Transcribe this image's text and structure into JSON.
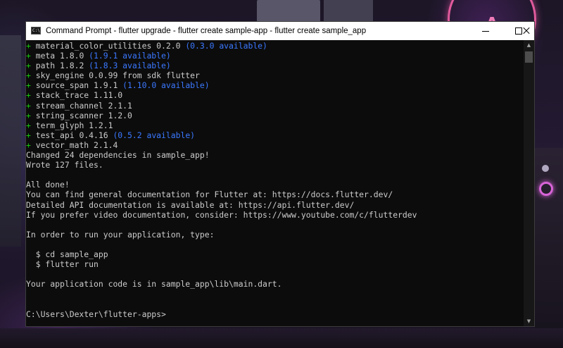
{
  "window": {
    "title": "Command Prompt - flutter  upgrade - flutter  create sample-app - flutter  create sample_app",
    "app_icon_text": "C:\\",
    "controls": {
      "minimize_icon": "minimize-icon",
      "maximize_icon": "maximize-icon",
      "close_icon": "close-icon"
    }
  },
  "colors": {
    "console_bg": "#0c0c0c",
    "console_text": "#cccccc",
    "plus_green": "#16c60c",
    "available_blue": "#3b78ff"
  },
  "console": {
    "lines": [
      {
        "prefix": "+ ",
        "text": "material_color_utilities 0.2.0 ",
        "note": "(0.3.0 available)"
      },
      {
        "prefix": "+ ",
        "text": "meta 1.8.0 ",
        "note": "(1.9.1 available)"
      },
      {
        "prefix": "+ ",
        "text": "path 1.8.2 ",
        "note": "(1.8.3 available)"
      },
      {
        "prefix": "+ ",
        "text": "sky_engine 0.0.99 from sdk flutter",
        "note": ""
      },
      {
        "prefix": "+ ",
        "text": "source_span 1.9.1 ",
        "note": "(1.10.0 available)"
      },
      {
        "prefix": "+ ",
        "text": "stack_trace 1.11.0",
        "note": ""
      },
      {
        "prefix": "+ ",
        "text": "stream_channel 2.1.1",
        "note": ""
      },
      {
        "prefix": "+ ",
        "text": "string_scanner 1.2.0",
        "note": ""
      },
      {
        "prefix": "+ ",
        "text": "term_glyph 1.2.1",
        "note": ""
      },
      {
        "prefix": "+ ",
        "text": "test_api 0.4.16 ",
        "note": "(0.5.2 available)"
      },
      {
        "prefix": "+ ",
        "text": "vector_math 2.1.4",
        "note": ""
      },
      {
        "prefix": "",
        "text": "Changed 24 dependencies in sample_app!",
        "note": ""
      },
      {
        "prefix": "",
        "text": "Wrote 127 files.",
        "note": ""
      },
      {
        "prefix": "",
        "text": "",
        "note": ""
      },
      {
        "prefix": "",
        "text": "All done!",
        "note": ""
      },
      {
        "prefix": "",
        "text": "You can find general documentation for Flutter at: https://docs.flutter.dev/",
        "note": ""
      },
      {
        "prefix": "",
        "text": "Detailed API documentation is available at: https://api.flutter.dev/",
        "note": ""
      },
      {
        "prefix": "",
        "text": "If you prefer video documentation, consider: https://www.youtube.com/c/flutterdev",
        "note": ""
      },
      {
        "prefix": "",
        "text": "",
        "note": ""
      },
      {
        "prefix": "",
        "text": "In order to run your application, type:",
        "note": ""
      },
      {
        "prefix": "",
        "text": "",
        "note": ""
      },
      {
        "prefix": "",
        "text": "  $ cd sample_app",
        "note": ""
      },
      {
        "prefix": "",
        "text": "  $ flutter run",
        "note": ""
      },
      {
        "prefix": "",
        "text": "",
        "note": ""
      },
      {
        "prefix": "",
        "text": "Your application code is in sample_app\\lib\\main.dart.",
        "note": ""
      },
      {
        "prefix": "",
        "text": "",
        "note": ""
      },
      {
        "prefix": "",
        "text": "",
        "note": ""
      },
      {
        "prefix": "",
        "text": "C:\\Users\\Dexter\\flutter-apps>",
        "note": ""
      }
    ]
  },
  "scrollbar": {
    "up_arrow": "▲",
    "down_arrow": "▼"
  }
}
